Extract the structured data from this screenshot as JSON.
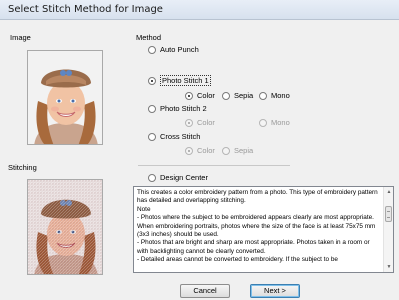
{
  "window": {
    "title": "Select Stitch Method for Image"
  },
  "left": {
    "image_label": "Image",
    "stitching_label": "Stitching"
  },
  "method": {
    "label": "Method",
    "auto_punch": "Auto Punch",
    "photo_stitch_1": "Photo Stitch 1",
    "photo_stitch_1_options": {
      "color": "Color",
      "sepia": "Sepia",
      "mono": "Mono"
    },
    "photo_stitch_2": "Photo Stitch 2",
    "photo_stitch_2_options": {
      "color": "Color",
      "mono": "Mono"
    },
    "cross_stitch": "Cross Stitch",
    "cross_stitch_options": {
      "color": "Color",
      "sepia": "Sepia"
    },
    "design_center": "Design Center",
    "selected": "Photo Stitch 1",
    "selected_color_mode": "Color"
  },
  "description": "This creates a color embroidery pattern from a photo. This type of embroidery pattern has detailed and overlapping stitching.\nNote\n- Photos where the subject to be embroidered appears clearly are most appropriate. When embroidering portraits, photos where the size of the face is at least 75x75 mm (3x3 inches) should be used.\n- Photos that are bright and sharp are most appropriate. Photos taken in a room or with backlighting cannot be clearly converted.\n- Detailed areas cannot be converted to embroidery. If the subject to be",
  "buttons": {
    "cancel": "Cancel",
    "next": "Next >"
  }
}
